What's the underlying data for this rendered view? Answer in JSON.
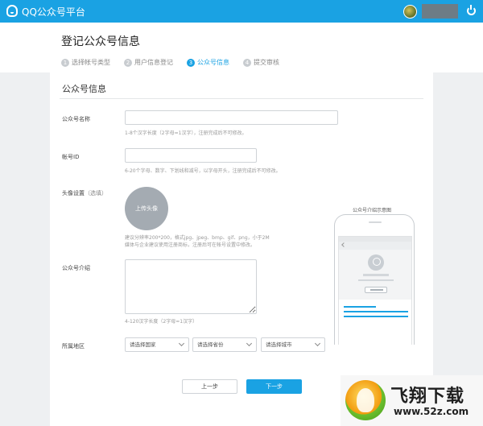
{
  "topbar": {
    "app_title": "QQ公众号平台",
    "logo_icon": "qq-logo-icon",
    "avatar_icon": "user-avatar",
    "power_icon": "power-icon",
    "color": "#1aa2e3"
  },
  "header": {
    "title": "登记公众号信息",
    "steps": [
      {
        "num": "1",
        "label": "选择帐号类型",
        "active": false
      },
      {
        "num": "2",
        "label": "用户信息登记",
        "active": false
      },
      {
        "num": "3",
        "label": "公众号信息",
        "active": true
      },
      {
        "num": "4",
        "label": "提交审核",
        "active": false
      }
    ]
  },
  "form": {
    "section_title": "公众号信息",
    "name": {
      "label": "公众号名称",
      "value": "",
      "hint": "1-8个汉字长度（2字母=1汉字），注册完成后不可修改。"
    },
    "account_id": {
      "label": "帐号ID",
      "value": "",
      "hint": "6-20个字母、数字、下划线和减号，以字母开头，注册完成后不可修改。"
    },
    "avatar": {
      "label": "头像设置",
      "optional": "（选填）",
      "upload_label": "上传头像",
      "hint_line1": "建议分辨率200*200，格式jpg、jpeg、bmp、gif、png，小于2M",
      "hint_line2": "媒体与企业建议使用注册商标，注册后可在帐号设置中修改。"
    },
    "intro": {
      "label": "公众号介绍",
      "value": "",
      "hint": "4-120汉字长度（2字母=1汉字）"
    },
    "region": {
      "label": "所属地区",
      "country_placeholder": "请选择国家",
      "province_placeholder": "请选择省份",
      "city_placeholder": "请选择城市"
    },
    "prev_button": "上一步",
    "next_button": "下一步"
  },
  "preview": {
    "caption": "公众号介绍示意图"
  },
  "watermark": {
    "text": "飞翔下载",
    "url": "www.52z.com"
  }
}
